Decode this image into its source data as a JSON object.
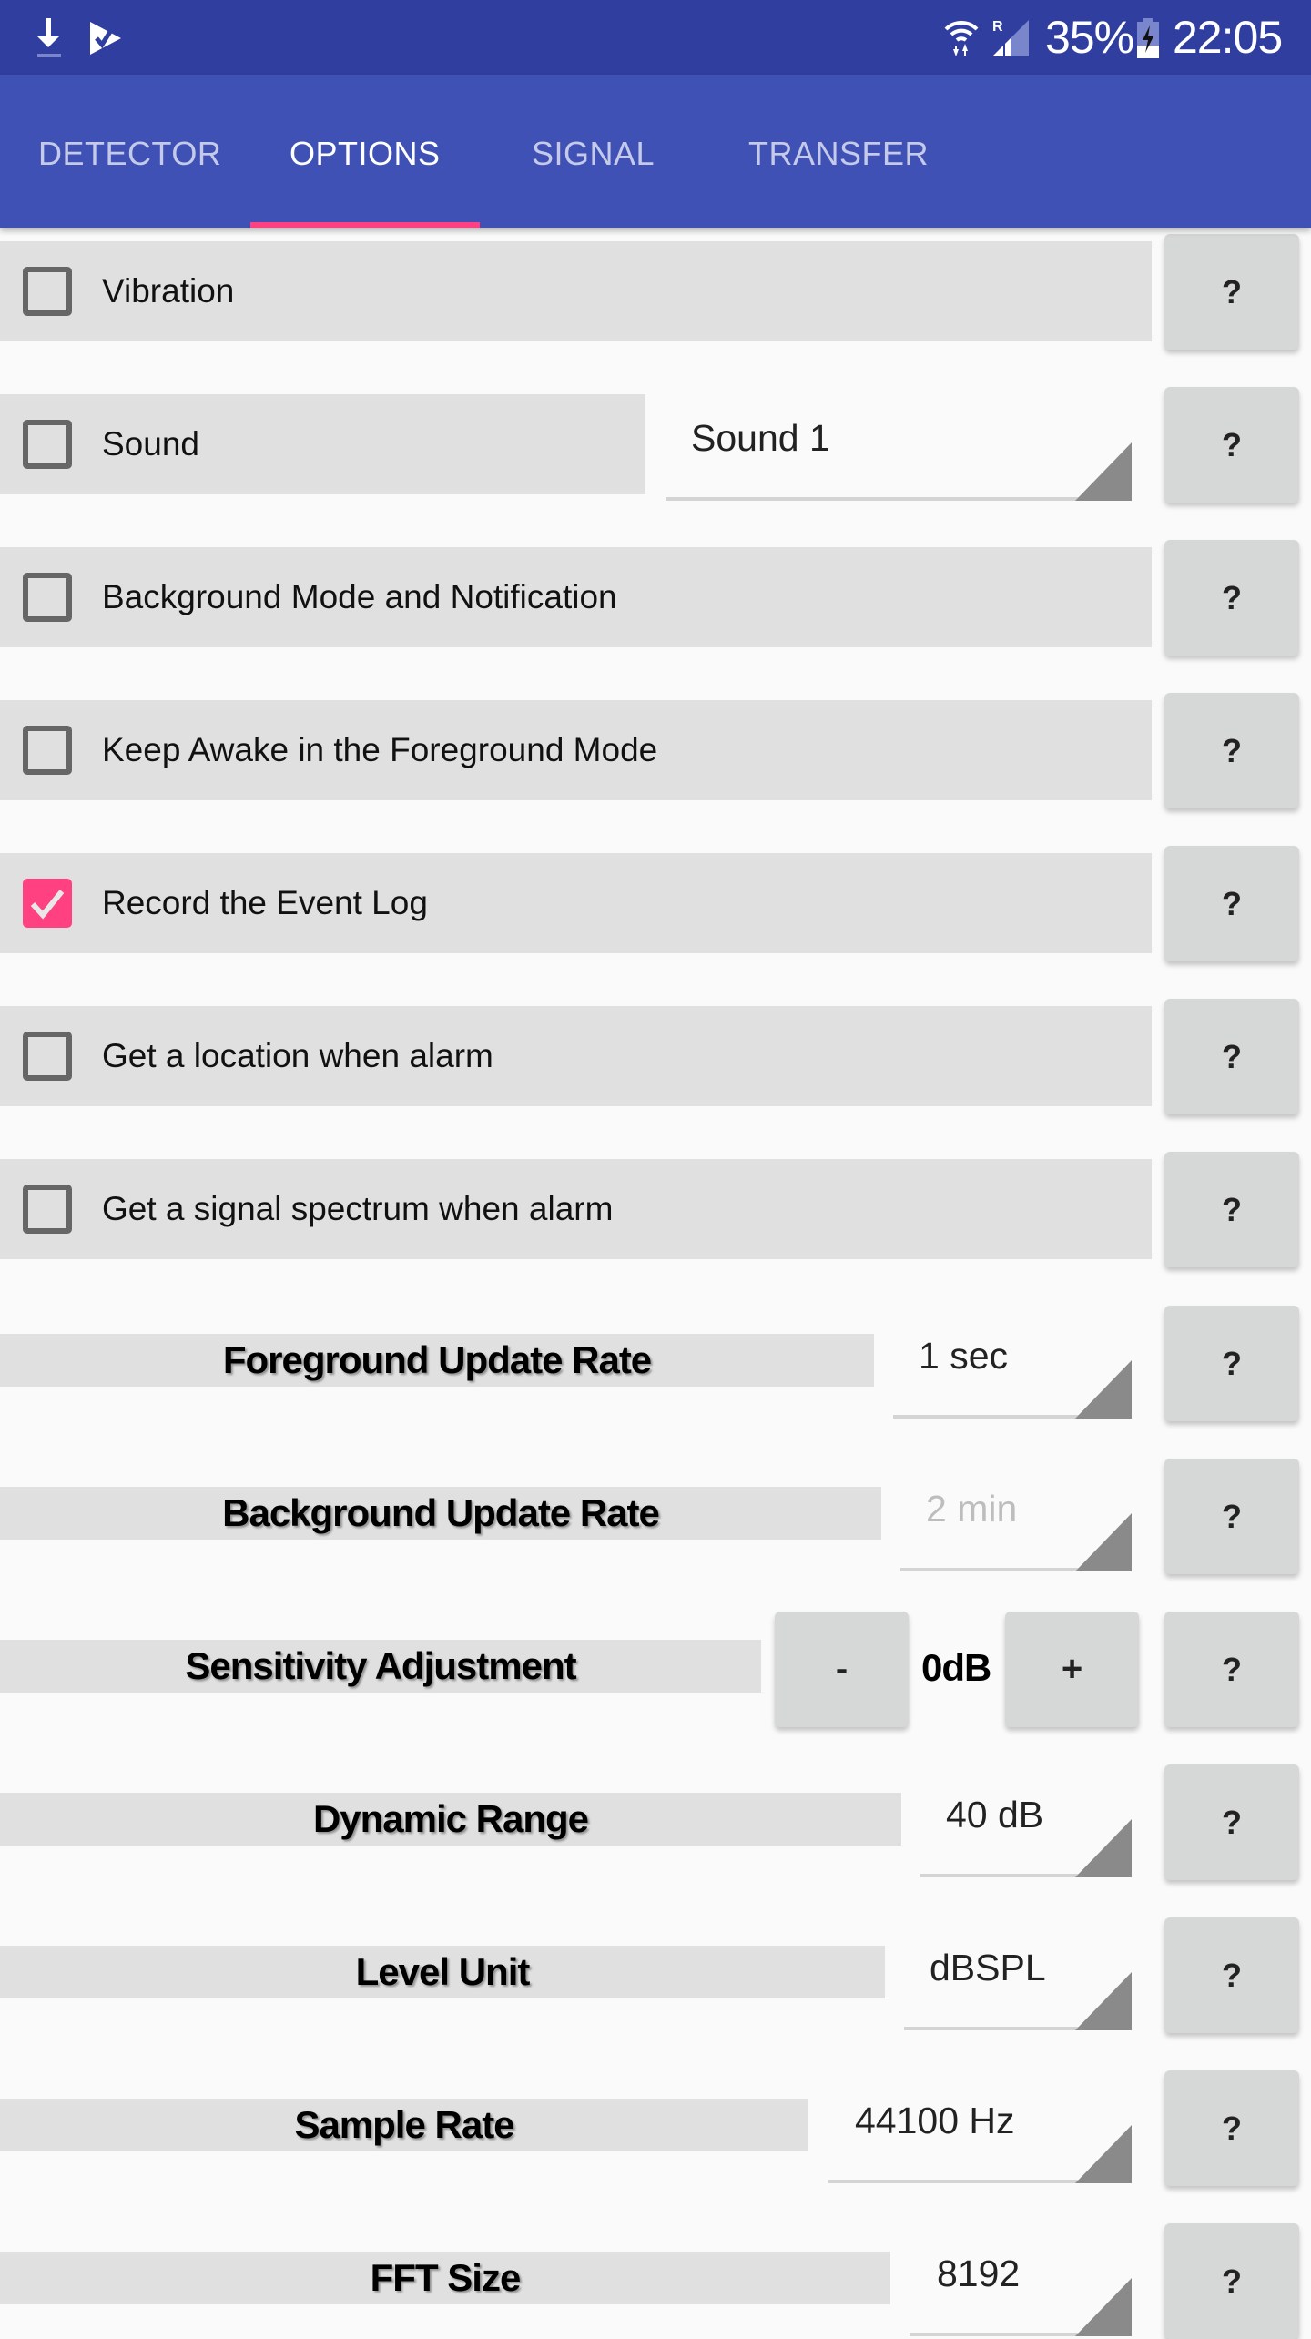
{
  "status_bar": {
    "left_icons": [
      "download-icon",
      "play-store-check-icon"
    ],
    "right_icons": [
      "wifi-icon",
      "roaming-signal-icon",
      "battery-charging-icon"
    ],
    "roaming_label": "R",
    "battery_percent": "35%",
    "time": "22:05"
  },
  "tabs": [
    {
      "label": "DETECTOR",
      "active": false
    },
    {
      "label": "OPTIONS",
      "active": true
    },
    {
      "label": "SIGNAL",
      "active": false
    },
    {
      "label": "TRANSFER",
      "active": false
    }
  ],
  "colors": {
    "status_bar": "#303f9f",
    "primary": "#3f51b5",
    "accent": "#ff4081",
    "row_bg": "#e0e0e0",
    "button_bg": "#d6d7d7",
    "page_bg": "#fafafa"
  },
  "help_label": "?",
  "checkbox_options": [
    {
      "label": "Vibration",
      "checked": false
    },
    {
      "label": "Sound",
      "checked": false,
      "dropdown_value": "Sound 1"
    },
    {
      "label": "Background Mode and Notification",
      "checked": false
    },
    {
      "label": "Keep Awake in the Foreground Mode",
      "checked": false
    },
    {
      "label": "Record the Event Log",
      "checked": true
    },
    {
      "label": "Get a location when alarm",
      "checked": false
    },
    {
      "label": "Get a signal spectrum when alarm",
      "checked": false
    }
  ],
  "settings": [
    {
      "label": "Foreground Update Rate",
      "value": "1 sec",
      "enabled": true
    },
    {
      "label": "Background Update Rate",
      "value": "2 min",
      "enabled": false
    },
    {
      "label": "Sensitivity Adjustment",
      "value": "0dB",
      "decrement_label": "-",
      "increment_label": "+"
    },
    {
      "label": "Dynamic Range",
      "value": "40 dB",
      "enabled": true
    },
    {
      "label": "Level Unit",
      "value": "dBSPL",
      "enabled": true
    },
    {
      "label": "Sample Rate",
      "value": "44100 Hz",
      "enabled": true
    },
    {
      "label": "FFT Size",
      "value": "8192",
      "enabled": true
    }
  ]
}
